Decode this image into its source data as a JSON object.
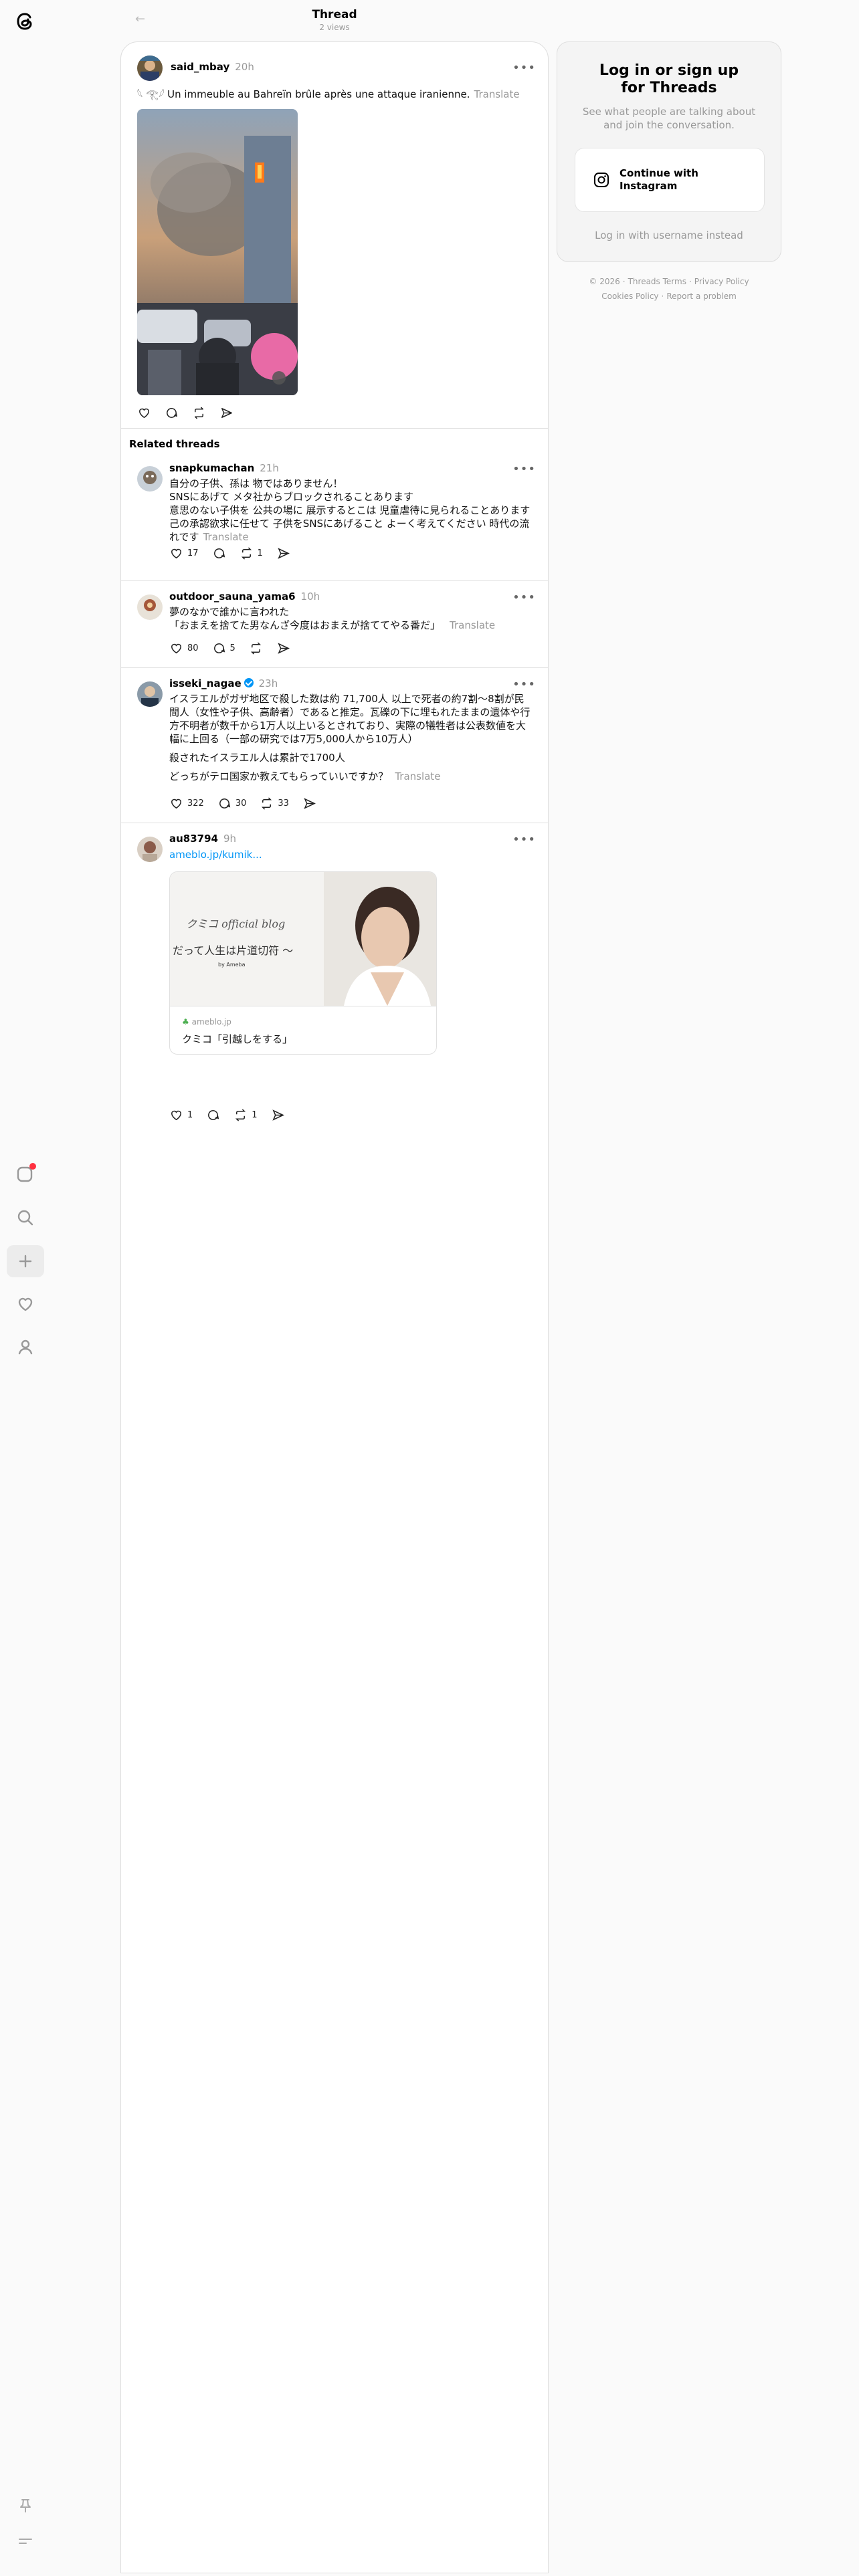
{
  "header": {
    "title": "Thread",
    "views": "2 views"
  },
  "main_post": {
    "username": "said_mbay",
    "time": "20h",
    "text": "𓆩 𓂀𓆪 Un immeuble au Bahreïn brûle après une attaque iranienne.",
    "translate": "Translate"
  },
  "related_heading": "Related threads",
  "related": [
    {
      "username": "snapkumachan",
      "time": "21h",
      "lines": [
        "自分の子供、孫は 物ではありません！",
        "SNSにあげて メタ社からブロックされることあります",
        "意思のない子供を 公共の場に 展示するとこは 児童虐待に見られることあります",
        "己の承認欲求に任せて 子供をSNSにあげること よーく考えてください 時代の流",
        "れです"
      ],
      "translate": "Translate",
      "likes": "17",
      "replies": "",
      "reposts": "1"
    },
    {
      "username": "outdoor_sauna_yama6",
      "time": "10h",
      "lines": [
        "夢のなかで誰かに言われた",
        "「おまえを捨てた男なんざ今度はおまえが捨ててやる番だ」"
      ],
      "translate": "Translate",
      "likes": "80",
      "replies": "5",
      "reposts": ""
    },
    {
      "username": "isseki_nagae",
      "time": "23h",
      "lines": [
        "イスラエルがガザ地区で殺した数は約 71,700人 以上で死者の約7割〜8割が民",
        "間人（女性や子供、高齢者）であると推定。瓦礫の下に埋もれたままの遺体や行",
        "方不明者が数千から1万人以上いるとされており、実際の犠牲者は公表数値を大",
        "幅に上回る（一部の研究では7万5,000人から10万人）"
      ],
      "line2": "殺されたイスラエル人は累計で1700人",
      "line3": "どっちがテロ国家か教えてもらっていいですか？",
      "translate": "Translate",
      "likes": "322",
      "replies": "30",
      "reposts": "33"
    },
    {
      "username": "au83794",
      "time": "9h",
      "link": "ameblo.jp/kumik...",
      "card": {
        "script": "クミコ official blog",
        "tagline": "だって人生は片道切符 〜",
        "brand": "by Ameba",
        "domain": "ameblo.jp",
        "title": "クミコ「引越しをする」"
      },
      "likes": "1",
      "replies": "",
      "reposts": "1"
    }
  ],
  "login": {
    "title_line1": "Log in or sign up",
    "title_line2": "for Threads",
    "subtitle": "See what people are talking about and join the conversation.",
    "button_line1": "Continue with",
    "button_line2": "Instagram",
    "alt": "Log in with username instead"
  },
  "footer": {
    "items": [
      "© 2026",
      "Threads Terms",
      "Privacy Policy",
      "Cookies Policy",
      "Report a problem"
    ]
  },
  "colors": {
    "accent": "#0095f6",
    "notification": "#ff3040",
    "link": "#0095f6"
  }
}
